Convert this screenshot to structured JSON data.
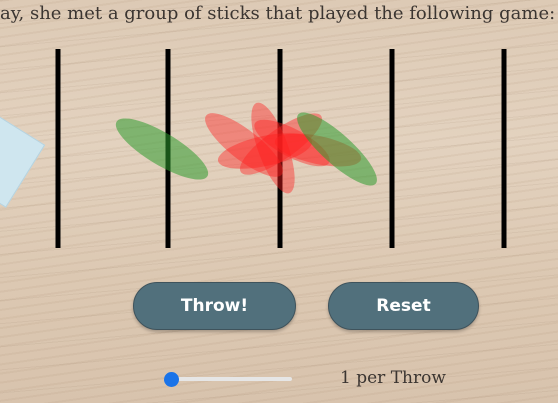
{
  "header": {
    "text": "ay, she met a group of sticks that played the following game:"
  },
  "buttons": {
    "throw_label": "Throw!",
    "reset_label": "Reset"
  },
  "slider": {
    "value": 1,
    "min": 1,
    "max": 100
  },
  "rate_text": "1 per Throw",
  "lines": {
    "count": 5,
    "color": "#000000"
  },
  "sticks": {
    "crossing_color": "#ff2020",
    "non_crossing_color": "#2e9a2e",
    "items": [
      {
        "crosses": false,
        "angle_deg": 31
      },
      {
        "crosses": true,
        "angle_deg": 38
      },
      {
        "crosses": true,
        "angle_deg": 70
      },
      {
        "crosses": true,
        "angle_deg": -35
      },
      {
        "crosses": true,
        "angle_deg": -12
      },
      {
        "crosses": true,
        "angle_deg": 12
      },
      {
        "crosses": true,
        "angle_deg": 28
      },
      {
        "crosses": false,
        "angle_deg": 42
      }
    ]
  }
}
